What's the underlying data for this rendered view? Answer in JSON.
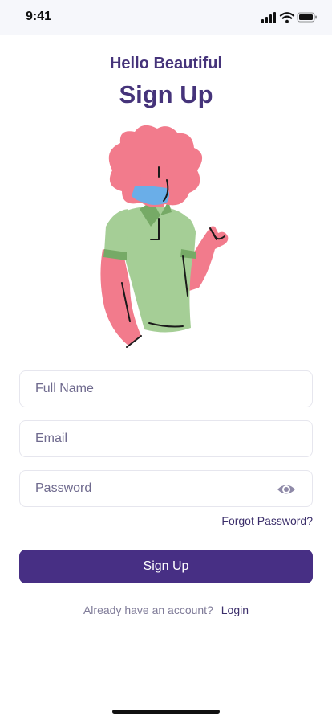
{
  "status_bar": {
    "time": "9:41",
    "icons": [
      "cellular-signal-icon",
      "wifi-icon",
      "battery-icon"
    ]
  },
  "header": {
    "greeting": "Hello Beautiful",
    "title": "Sign Up"
  },
  "illustration": {
    "name": "person-thumbs-up-illustration"
  },
  "form": {
    "full_name": {
      "placeholder": "Full Name",
      "value": ""
    },
    "email": {
      "placeholder": "Email",
      "value": ""
    },
    "password": {
      "placeholder": "Password",
      "value": ""
    },
    "forgot_password_label": "Forgot Password?",
    "submit_label": "Sign Up"
  },
  "footer": {
    "prompt": "Already have an account?",
    "login_label": "Login"
  },
  "colors": {
    "primary": "#472f84",
    "heading": "#45337a",
    "status_bar_bg": "#f6f7fb",
    "field_border": "#e6e6ee"
  }
}
